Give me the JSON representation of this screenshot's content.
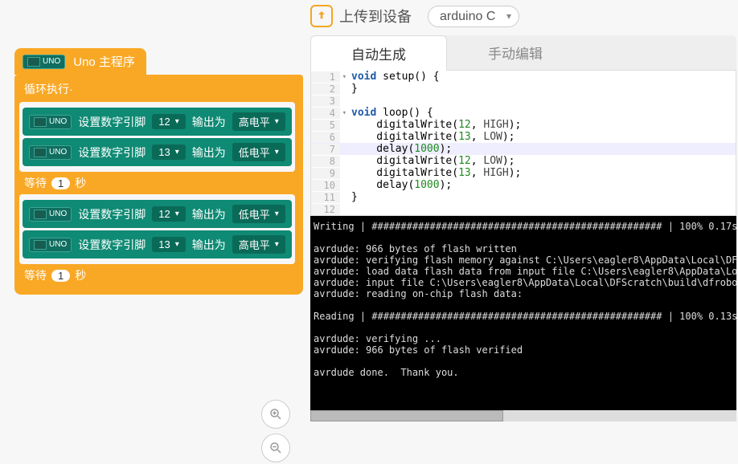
{
  "topbar": {
    "upload_label": "上传到设备",
    "board_selected": "arduino C"
  },
  "blocks": {
    "main_label": "Uno 主程序",
    "loop_label": "循环执行·",
    "set_pin_label": "设置数字引脚",
    "output_as_label": "输出为",
    "wait_label": "等待",
    "seconds_label": "秒",
    "high": "高电平",
    "low": "低电平",
    "rows": [
      {
        "pin": "12",
        "level": "high"
      },
      {
        "pin": "13",
        "level": "low"
      }
    ],
    "wait1": "1",
    "rows2": [
      {
        "pin": "12",
        "level": "low"
      },
      {
        "pin": "13",
        "level": "high"
      }
    ],
    "wait2": "1"
  },
  "tabs": {
    "auto": "自动生成",
    "manual": "手动编辑"
  },
  "code": {
    "lines": [
      {
        "n": 1,
        "fold": true,
        "txt": "void setup() {",
        "kw": "void"
      },
      {
        "n": 2,
        "txt": "}"
      },
      {
        "n": 3,
        "txt": ""
      },
      {
        "n": 4,
        "fold": true,
        "txt": "void loop() {",
        "kw": "void"
      },
      {
        "n": 5,
        "txt": "    digitalWrite(12, HIGH);",
        "nums": [
          "12"
        ],
        "cons": [
          "HIGH"
        ]
      },
      {
        "n": 6,
        "txt": "    digitalWrite(13, LOW);",
        "nums": [
          "13"
        ],
        "cons": [
          "LOW"
        ]
      },
      {
        "n": 7,
        "hl": true,
        "txt": "    delay(1000);",
        "nums": [
          "1000"
        ]
      },
      {
        "n": 8,
        "txt": "    digitalWrite(12, LOW);",
        "nums": [
          "12"
        ],
        "cons": [
          "LOW"
        ]
      },
      {
        "n": 9,
        "txt": "    digitalWrite(13, HIGH);",
        "nums": [
          "13"
        ],
        "cons": [
          "HIGH"
        ]
      },
      {
        "n": 10,
        "txt": "    delay(1000);",
        "nums": [
          "1000"
        ]
      },
      {
        "n": 11,
        "txt": "}"
      },
      {
        "n": 12,
        "txt": ""
      }
    ]
  },
  "console_text": "Writing | ################################################## | 100% 0.17s\n\navrdude: 966 bytes of flash written\navrdude: verifying flash memory against C:\\Users\\eagler8\\AppData\\Local\\DFScra\navrdude: load data flash data from input file C:\\Users\\eagler8\\AppData\\Local\\\navrdude: input file C:\\Users\\eagler8\\AppData\\Local\\DFScratch\\build\\dfrobot.in\navrdude: reading on-chip flash data:\n\nReading | ################################################## | 100% 0.13s\n\navrdude: verifying ...\navrdude: 966 bytes of flash verified\n\navrdude done.  Thank you.\n"
}
